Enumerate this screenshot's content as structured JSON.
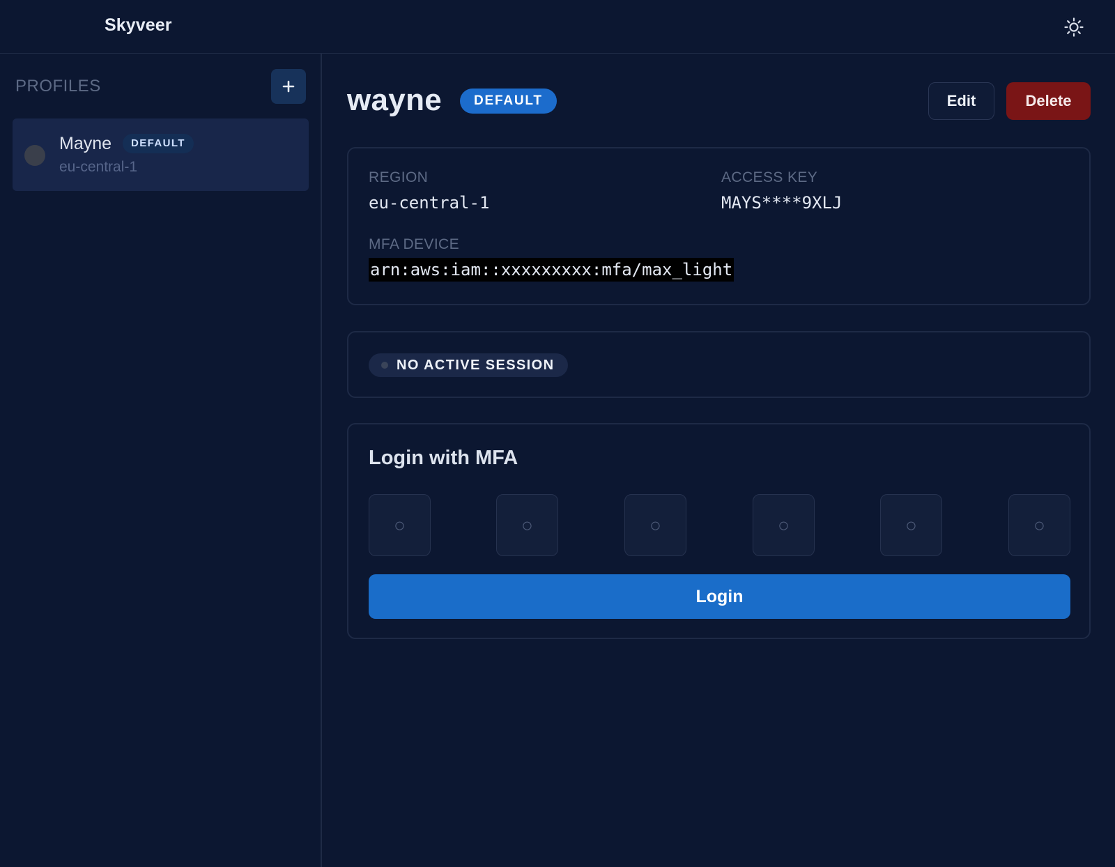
{
  "header": {
    "title": "Skyveer",
    "theme_icon": "sun-icon"
  },
  "sidebar": {
    "heading": "PROFILES",
    "add_icon": "plus-icon",
    "profiles": [
      {
        "name": "Mayne",
        "badge": "DEFAULT",
        "region": "eu-central-1"
      }
    ]
  },
  "main": {
    "title": "wayne",
    "badge": "DEFAULT",
    "edit_label": "Edit",
    "delete_label": "Delete",
    "details": {
      "region_label": "REGION",
      "region_value": "eu-central-1",
      "access_key_label": "ACCESS KEY",
      "access_key_value": "MAYS****9XLJ",
      "mfa_label": "MFA DEVICE",
      "mfa_value": "arn:aws:iam::xxxxxxxxx:mfa/max_light"
    },
    "session": {
      "status": "NO ACTIVE SESSION"
    },
    "login": {
      "heading": "Login with MFA",
      "otp_placeholders": [
        "○",
        "○",
        "○",
        "○",
        "○",
        "○"
      ],
      "button_label": "Login"
    }
  },
  "colors": {
    "background": "#0c1731",
    "primary": "#1a6dc9",
    "danger": "#7a1516",
    "muted_text": "#5d6a85"
  }
}
